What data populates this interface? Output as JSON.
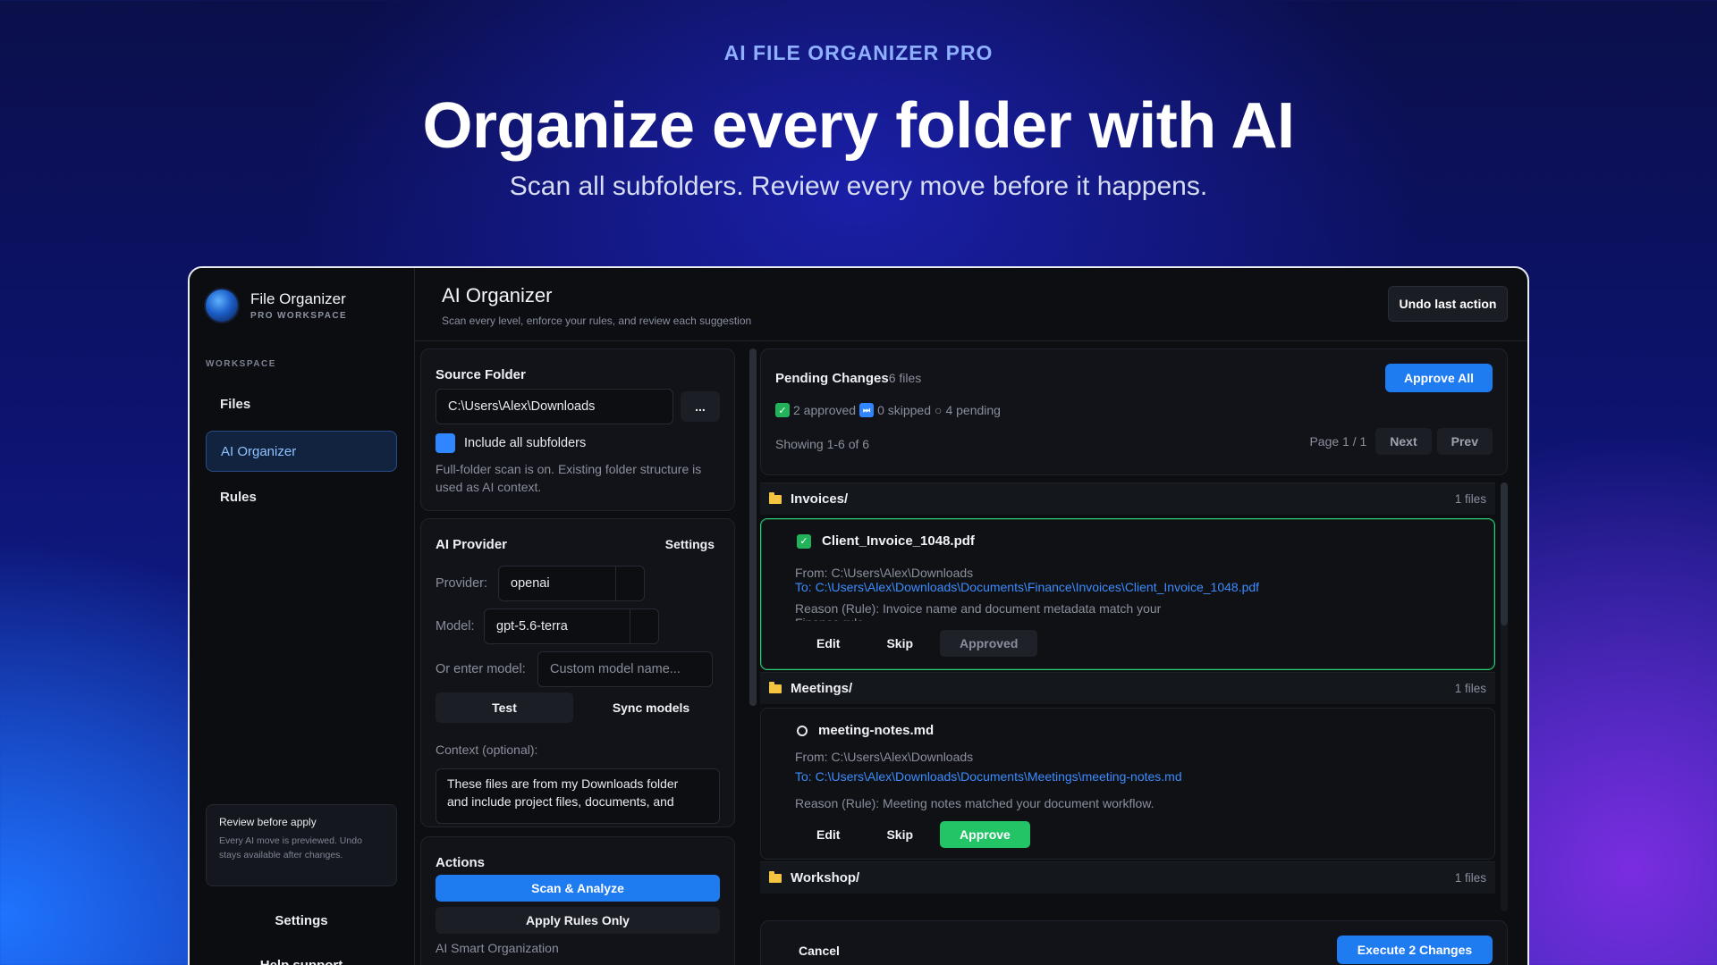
{
  "hero": {
    "eyebrow": "AI FILE ORGANIZER PRO",
    "headline": "Organize every folder with AI",
    "subline": "Scan all subfolders. Review every move before it happens."
  },
  "sidebar": {
    "brand_name": "File Organizer",
    "brand_sub": "PRO WORKSPACE",
    "section_label": "WORKSPACE",
    "items": [
      {
        "label": "Files"
      },
      {
        "label": "AI Organizer"
      },
      {
        "label": "Rules"
      }
    ],
    "review_title": "Review before apply",
    "review_body": "Every AI move is previewed. Undo stays available after changes.",
    "settings_label": "Settings",
    "help_label": "Help  support"
  },
  "header": {
    "title": "AI Organizer",
    "subtitle": "Scan every level, enforce your rules, and review each suggestion",
    "undo_label": "Undo last action"
  },
  "source": {
    "heading": "Source Folder",
    "path": "C:\\Users\\Alex\\Downloads",
    "browse_label": "...",
    "include_label": "Include all subfolders",
    "note": "Full-folder scan is on. Existing folder structure is used as AI context."
  },
  "provider": {
    "heading": "AI Provider",
    "settings_label": "Settings",
    "provider_label": "Provider:",
    "provider_value": "openai",
    "model_label": "Model:",
    "model_value": "gpt-5.6-terra",
    "custom_label": "Or enter model:",
    "custom_placeholder": "Custom model name...",
    "test_label": "Test",
    "sync_label": "Sync models",
    "context_label": "Context (optional):",
    "context_value": "These files are from my Downloads folder and include project files, documents, and"
  },
  "actions": {
    "heading": "Actions",
    "scan_label": "Scan & Analyze",
    "apply_rules_label": "Apply Rules Only",
    "smart_label": "AI Smart Organization"
  },
  "pending": {
    "title": "Pending Changes",
    "count": "6 files",
    "approve_all": "Approve All",
    "approved_text": "2 approved",
    "skipped_text": "0 skipped",
    "pending_text": "4 pending",
    "showing": "Showing 1-6 of 6",
    "page_label": "Page 1 / 1",
    "next_label": "Next",
    "prev_label": "Prev"
  },
  "groups": [
    {
      "name": "Invoices/",
      "files_label": "1 files",
      "file": {
        "name": "Client_Invoice_1048.pdf",
        "from": "From: C:\\Users\\Alex\\Downloads",
        "to": "To: C:\\Users\\Alex\\Downloads\\Documents\\Finance\\Invoices\\Client_Invoice_1048.pdf",
        "reason": "Reason (Rule): Invoice name and document metadata match your Finance rule.",
        "edit": "Edit",
        "skip": "Skip",
        "status": "Approved"
      }
    },
    {
      "name": "Meetings/",
      "files_label": "1 files",
      "file": {
        "name": "meeting-notes.md",
        "from": "From: C:\\Users\\Alex\\Downloads",
        "to": "To: C:\\Users\\Alex\\Downloads\\Documents\\Meetings\\meeting-notes.md",
        "reason": "Reason (Rule): Meeting notes matched your document workflow.",
        "edit": "Edit",
        "skip": "Skip",
        "status": "Approve"
      }
    },
    {
      "name": "Workshop/",
      "files_label": "1 files"
    }
  ],
  "footer": {
    "cancel_label": "Cancel",
    "execute_label": "Execute 2 Changes"
  },
  "colors": {
    "accent": "#1f7bf0",
    "success": "#22c466",
    "link": "#3c8cff",
    "folder": "#f5c542"
  }
}
